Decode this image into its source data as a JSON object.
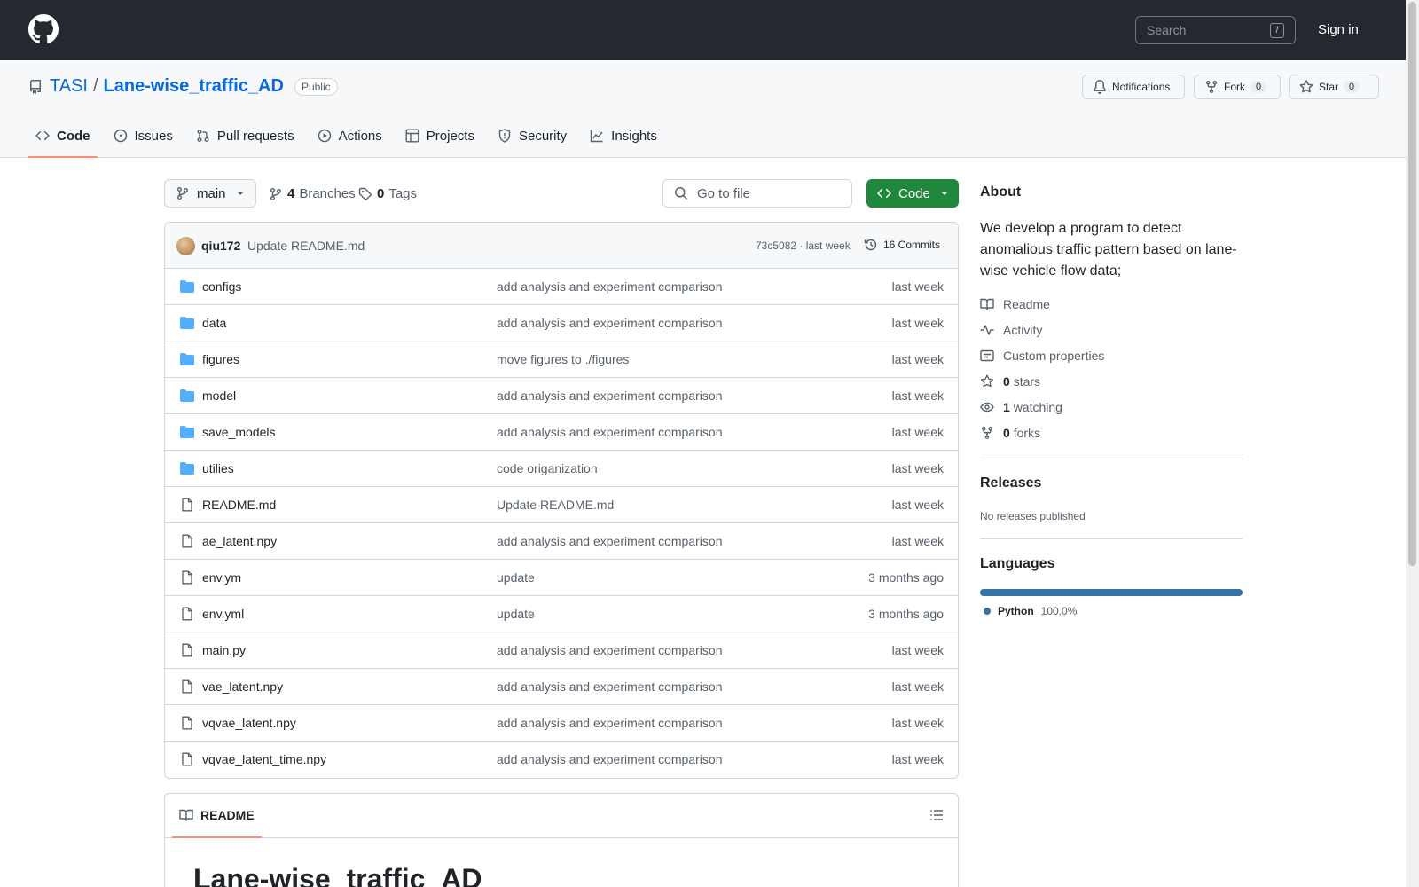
{
  "header": {
    "search_placeholder": "Search",
    "search_shortcut": "/",
    "signin_label": "Sign in",
    "logo_icon": "github-logo-icon"
  },
  "repo": {
    "owner": "TASI",
    "separator": "/",
    "name": "Lane-wise_traffic_AD",
    "visibility": "Public",
    "notifications_label": "Notifications",
    "fork_label": "Fork",
    "fork_count": "0",
    "star_label": "Star",
    "star_count": "0"
  },
  "tabs": [
    {
      "label": "Code",
      "icon": "code-icon",
      "active": true
    },
    {
      "label": "Issues",
      "icon": "issue-icon"
    },
    {
      "label": "Pull requests",
      "icon": "pull-request-icon"
    },
    {
      "label": "Actions",
      "icon": "play-icon"
    },
    {
      "label": "Projects",
      "icon": "table-icon"
    },
    {
      "label": "Security",
      "icon": "shield-icon"
    },
    {
      "label": "Insights",
      "icon": "graph-icon"
    }
  ],
  "toolbar": {
    "branch": "main",
    "branches_count": "4",
    "branches_label": "Branches",
    "tags_count": "0",
    "tags_label": "Tags",
    "goto_placeholder": "Go to file",
    "code_label": "Code"
  },
  "commit": {
    "author": "qiu172",
    "message": "Update README.md",
    "meta": "73c5082 · last week",
    "commits_label": "16 Commits"
  },
  "files": [
    {
      "name": "configs",
      "type": "dir",
      "message": "add analysis and experiment comparison",
      "time": "last week"
    },
    {
      "name": "data",
      "type": "dir",
      "message": "add analysis and experiment comparison",
      "time": "last week"
    },
    {
      "name": "figures",
      "type": "dir",
      "message": "move figures to ./figures",
      "time": "last week"
    },
    {
      "name": "model",
      "type": "dir",
      "message": "add analysis and experiment comparison",
      "time": "last week"
    },
    {
      "name": "save_models",
      "type": "dir",
      "message": "add analysis and experiment comparison",
      "time": "last week"
    },
    {
      "name": "utilies",
      "type": "dir",
      "message": "code origanization",
      "time": "last week"
    },
    {
      "name": "README.md",
      "type": "file",
      "message": "Update README.md",
      "time": "last week"
    },
    {
      "name": "ae_latent.npy",
      "type": "file",
      "message": "add analysis and experiment comparison",
      "time": "last week"
    },
    {
      "name": "env.ym",
      "type": "file",
      "message": "update",
      "time": "3 months ago"
    },
    {
      "name": "env.yml",
      "type": "file",
      "message": "update",
      "time": "3 months ago"
    },
    {
      "name": "main.py",
      "type": "file",
      "message": "add analysis and experiment comparison",
      "time": "last week"
    },
    {
      "name": "vae_latent.npy",
      "type": "file",
      "message": "add analysis and experiment comparison",
      "time": "last week"
    },
    {
      "name": "vqvae_latent.npy",
      "type": "file",
      "message": "add analysis and experiment comparison",
      "time": "last week"
    },
    {
      "name": "vqvae_latent_time.npy",
      "type": "file",
      "message": "add analysis and experiment comparison",
      "time": "last week"
    }
  ],
  "readme": {
    "tab_label": "README",
    "heading": "Lane-wise_traffic_AD"
  },
  "about": {
    "heading": "About",
    "description": "We develop a program to detect anomalious traffic pattern based on lane-wise vehicle flow data;",
    "readme_label": "Readme",
    "activity_label": "Activity",
    "custom_props_label": "Custom properties",
    "stars_count": "0",
    "stars_label": "stars",
    "watching_count": "1",
    "watching_label": "watching",
    "forks_count": "0",
    "forks_label": "forks"
  },
  "releases": {
    "heading": "Releases",
    "empty": "No releases published"
  },
  "languages": {
    "heading": "Languages",
    "items": [
      {
        "name": "Python",
        "percent": "100.0%",
        "color": "#3572A5"
      }
    ]
  },
  "colors": {
    "header_bg": "#24292f",
    "accent_green": "#1f883d",
    "link_blue": "#0969da",
    "tab_underline": "#fd8c73"
  }
}
